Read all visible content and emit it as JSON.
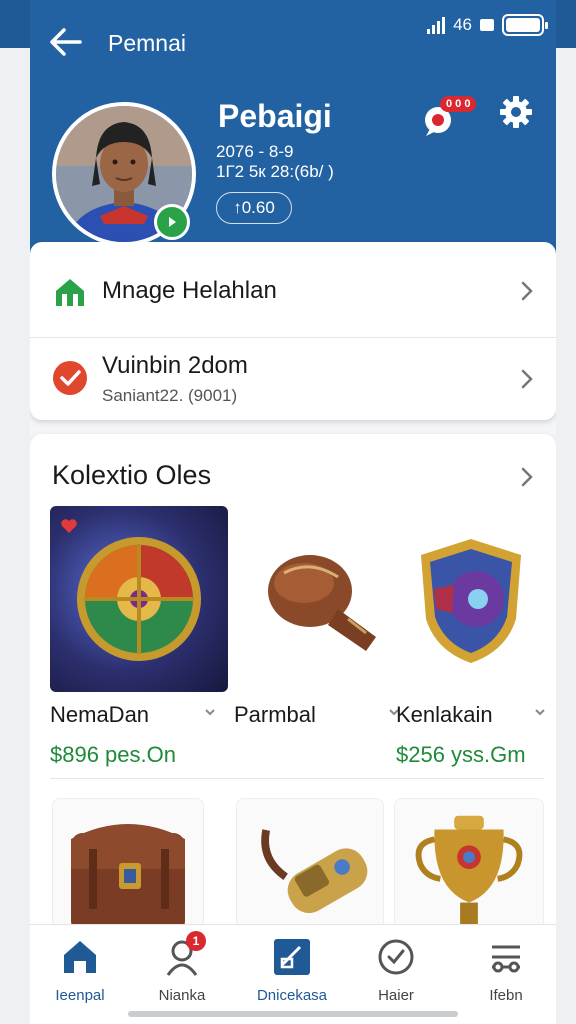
{
  "header": {
    "title": "Pemnai",
    "status_time": "46",
    "profile": {
      "name": "Pebaigi",
      "date": "2076 - 8-9",
      "stats": "1Г2 5к 28:(6b/ )",
      "pill": "↑0.60"
    },
    "chat_badge": "0 0 0"
  },
  "menu": {
    "row1": {
      "title": "Mnage Helahlan"
    },
    "row2": {
      "title": "Vuinbin 2dom",
      "subtitle": "Saniant22. (9001)"
    }
  },
  "collection": {
    "title": "Kolextio Oles",
    "items": [
      {
        "name": "NemaDan",
        "price": "$896 pes.On"
      },
      {
        "name": "Parmbal",
        "price": ""
      },
      {
        "name": "Kenlakain",
        "price": "$256  yss.Gm"
      }
    ]
  },
  "bottom_nav": [
    {
      "label": "Ieenpal",
      "icon": "home-icon"
    },
    {
      "label": "Nianka",
      "icon": "profile-icon",
      "badge": "1"
    },
    {
      "label": "Dnicekasa",
      "icon": "card-icon"
    },
    {
      "label": "Haier",
      "icon": "clock-icon"
    },
    {
      "label": "Ifebn",
      "icon": "settings-sliders-icon"
    }
  ],
  "colors": {
    "header": "#2362a2",
    "accent_green": "#2aa248",
    "badge_red": "#d9282f",
    "price_green": "#1f8a3a"
  }
}
